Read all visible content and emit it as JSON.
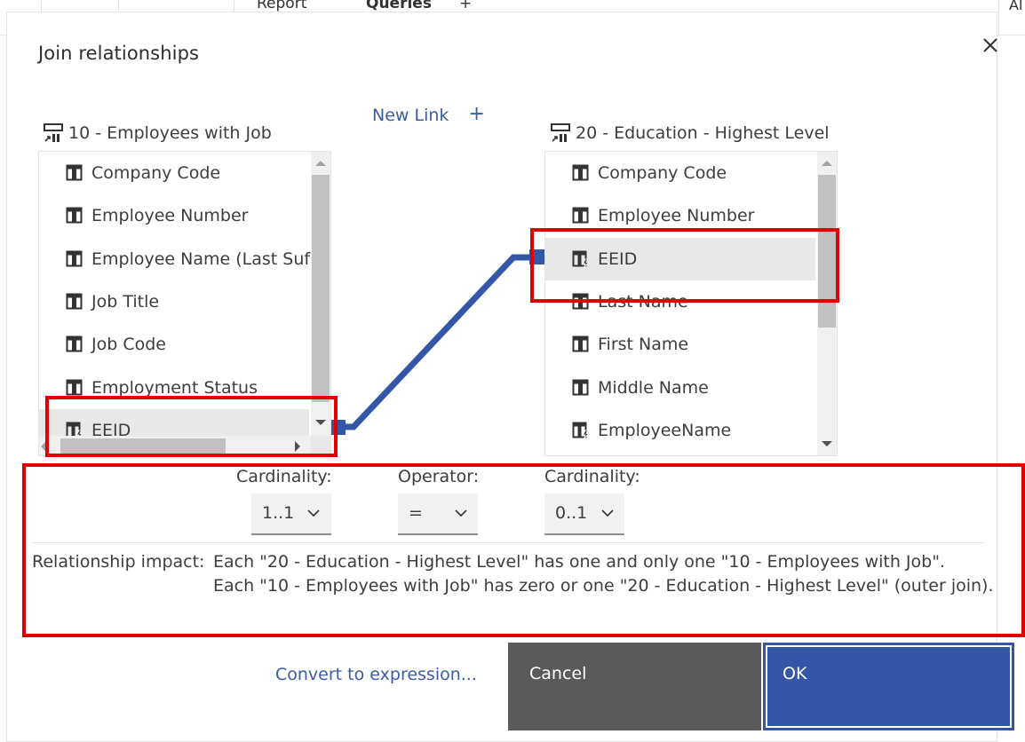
{
  "background": {
    "breadcrumb": [
      "Report",
      "Queries"
    ],
    "add_label": "+",
    "right_stub": "Al"
  },
  "dialog": {
    "title": "Join relationships",
    "close_icon": "close-icon"
  },
  "left_query": {
    "icon": "query-icon",
    "title": "10 - Employees with Job",
    "items": [
      {
        "label": "Company Code",
        "icon": "column-icon"
      },
      {
        "label": "Employee Number",
        "icon": "column-icon"
      },
      {
        "label": "Employee Name (Last Suf",
        "icon": "column-icon"
      },
      {
        "label": "Job Title",
        "icon": "column-icon"
      },
      {
        "label": "Job Code",
        "icon": "column-icon"
      },
      {
        "label": "Employment Status",
        "icon": "column-icon"
      },
      {
        "label": "EEID",
        "icon": "calculated-column-icon",
        "selected": true
      }
    ]
  },
  "new_link": {
    "label": "New Link",
    "plus": "+"
  },
  "right_query": {
    "icon": "query-icon",
    "title": "20 - Education - Highest Level",
    "items": [
      {
        "label": "Company Code",
        "icon": "column-icon"
      },
      {
        "label": "Employee Number",
        "icon": "column-icon"
      },
      {
        "label": "EEID",
        "icon": "calculated-column-icon",
        "selected": true
      },
      {
        "label": "Last Name",
        "icon": "column-icon"
      },
      {
        "label": "First Name",
        "icon": "column-icon"
      },
      {
        "label": "Middle Name",
        "icon": "column-icon"
      },
      {
        "label": "EmployeeName",
        "icon": "calculated-column-icon"
      }
    ]
  },
  "link": {
    "from": "EEID",
    "to": "EEID",
    "color": "#3356a6"
  },
  "controls": {
    "left_cardinality": {
      "label": "Cardinality:",
      "value": "1..1"
    },
    "operator": {
      "label": "Operator:",
      "value": "="
    },
    "right_cardinality": {
      "label": "Cardinality:",
      "value": "0..1"
    }
  },
  "impact": {
    "label": "Relationship impact:",
    "lines": [
      "Each \"20 - Education - Highest Level\" has one and only one \"10 - Employees with Job\".",
      "Each \"10 - Employees with Job\" has zero or one \"20 - Education - Highest Level\" (outer join)."
    ]
  },
  "footer": {
    "convert_label": "Convert to expression...",
    "cancel_label": "Cancel",
    "ok_label": "OK"
  },
  "colors": {
    "accent": "#3356a6",
    "link_text": "#3b5ba5",
    "cancel_bg": "#5a5a5a",
    "annotation": "#e00000",
    "selected_row": "#e8e8e8"
  }
}
